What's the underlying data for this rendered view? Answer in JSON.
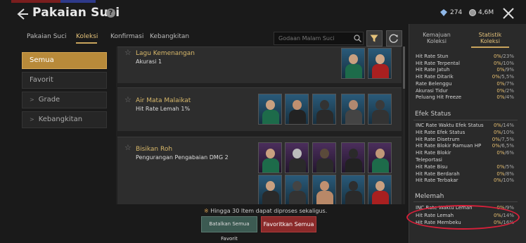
{
  "header": {
    "title": "Pakaian Suci",
    "gem_count": "274",
    "coin_count": "4,6M"
  },
  "tabs": [
    {
      "label": "Pakaian Suci"
    },
    {
      "label": "Koleksi"
    },
    {
      "label": "Konfirmasi"
    },
    {
      "label": "Kebangkitan"
    }
  ],
  "search": {
    "placeholder": "Godaan Malam Suci"
  },
  "menu": [
    {
      "label": "Semua"
    },
    {
      "label": "Favorit"
    },
    {
      "label": "Grade"
    },
    {
      "label": "Kebangkitan"
    }
  ],
  "collections": [
    {
      "name": "Lagu Kemenangan",
      "effect": "Akurasi 1"
    },
    {
      "name": "Air Mata Malaikat",
      "effect": "Hit Rate Lemah 1%"
    },
    {
      "name": "Bisikan Roh",
      "effect": "Pengurangan Pengabaian DMG 2"
    }
  ],
  "footer": {
    "notice": "Hingga 30 Item dapat diproses sekaligus.",
    "cancel_label": "Batalkan Semua Favorit",
    "favorite_label": "Favoritkan Semua"
  },
  "right_panel": {
    "tab1_line1": "Kemajuan",
    "tab1_line2": "Koleksi",
    "tab2_line1": "Statistik",
    "tab2_line2": "Koleksi",
    "stats_general": [
      {
        "label": "Hit Rate Stun",
        "cur": "0%",
        "max": "/23%"
      },
      {
        "label": "Hit Rate Terpental",
        "cur": "0%",
        "max": "/10%"
      },
      {
        "label": "Hit Rate Jatuh",
        "cur": "0%",
        "max": "/9%"
      },
      {
        "label": "Hit Rate Ditarik",
        "cur": "0%",
        "max": "/5,5%"
      },
      {
        "label": "Rate Belenggu",
        "cur": "0%",
        "max": "/7%"
      },
      {
        "label": "Akurasi Tidur",
        "cur": "0%",
        "max": "/2%"
      },
      {
        "label": "Peluang Hit Freeze",
        "cur": "0%",
        "max": "/4%"
      }
    ],
    "section_status": "Efek Status",
    "stats_status": [
      {
        "label": "INC Rate Waktu Efek Status",
        "cur": "0%",
        "max": "/14%"
      },
      {
        "label": "Hit Rate Efek Status",
        "cur": "0%",
        "max": "/10%"
      },
      {
        "label": "Hit Rate Disetrum",
        "cur": "0%",
        "max": "/7,5%"
      },
      {
        "label": "Hit Rate Blokir Ramuan HP",
        "cur": "0%",
        "max": "/6,5%"
      },
      {
        "label": "Hit Rate Blokir",
        "cur": "0%",
        "max": "/6%"
      },
      {
        "label": "Teleportasi",
        "cur": "",
        "max": ""
      },
      {
        "label": "Hit Rate Bisu",
        "cur": "0%",
        "max": "/5%"
      },
      {
        "label": "Hit Rate Berdarah",
        "cur": "0%",
        "max": "/8%"
      },
      {
        "label": "Hit Rate Terbakar",
        "cur": "0%",
        "max": "/10%"
      }
    ],
    "section_weak": "Melemah",
    "stats_weak": [
      {
        "label": "INC Rate Waktu Lemah",
        "cur": "0%",
        "max": "/9%"
      },
      {
        "label": "Hit Rate Lemah",
        "cur": "0%",
        "max": "/14%"
      },
      {
        "label": "Hit Rate Membeku",
        "cur": "0%",
        "max": "/16%"
      }
    ]
  },
  "colors": {
    "accent_gold": "#c9a45c",
    "menu_active": "#b88a3a",
    "favorite_button": "#8a2a2a",
    "cancel_button": "#3c5a52",
    "highlight_circle": "#d8203a"
  }
}
